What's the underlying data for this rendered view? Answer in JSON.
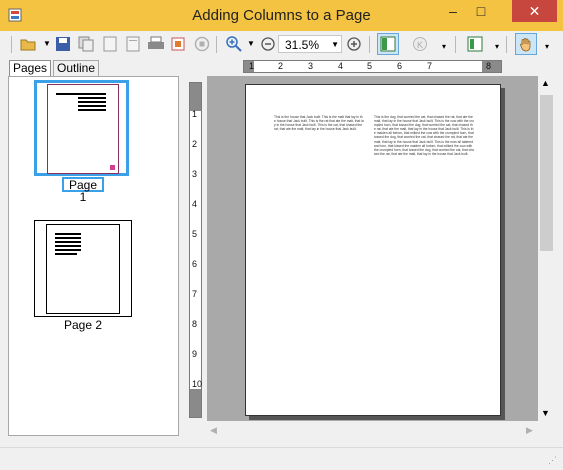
{
  "window": {
    "title": "Adding Columns to a Page",
    "minimize": "–",
    "maximize": "□",
    "close": "✕"
  },
  "toolbar": {
    "zoom_value": "31.5%"
  },
  "tabs": [
    "Pages",
    "Outline"
  ],
  "thumbnails": [
    {
      "label": "Page 1"
    },
    {
      "label": "Page 2"
    }
  ],
  "hruler": {
    "numbers": [
      "1",
      "2",
      "3",
      "4",
      "5",
      "6",
      "7",
      "8"
    ]
  },
  "vruler": {
    "numbers": [
      "1",
      "2",
      "3",
      "4",
      "5",
      "6",
      "7",
      "8",
      "9",
      "10"
    ]
  },
  "page": {
    "column1": "This is the house that Jack built. This is the malt that lay in the house that Jack built. This is the rat that ate the malt, that lay in the house that Jack built. This is the cat, that chased the rat, that ate the malt, that lay in the house that Jack built.",
    "column2": "This is the dog, that worried the cat, that chased the rat, that ate the malt, that lay in the house that Jack built. This is the cow with the crumpled horn, that tossed the dog, that worried the cat, that chased the rat, that ate the malt, that lay in the house that Jack built. This is the maiden all forlorn, that milked the cow with the crumpled horn, that tossed the dog, that worried the cat, that chased the rat, that ate the malt, that lay in the house that Jack built. This is the man all tattered and torn, that kissed the maiden all forlorn, that milked the cow with the crumpled horn, that tossed the dog, that worried the cat, that chased the rat, that ate the malt, that lay in the house that Jack built."
  }
}
